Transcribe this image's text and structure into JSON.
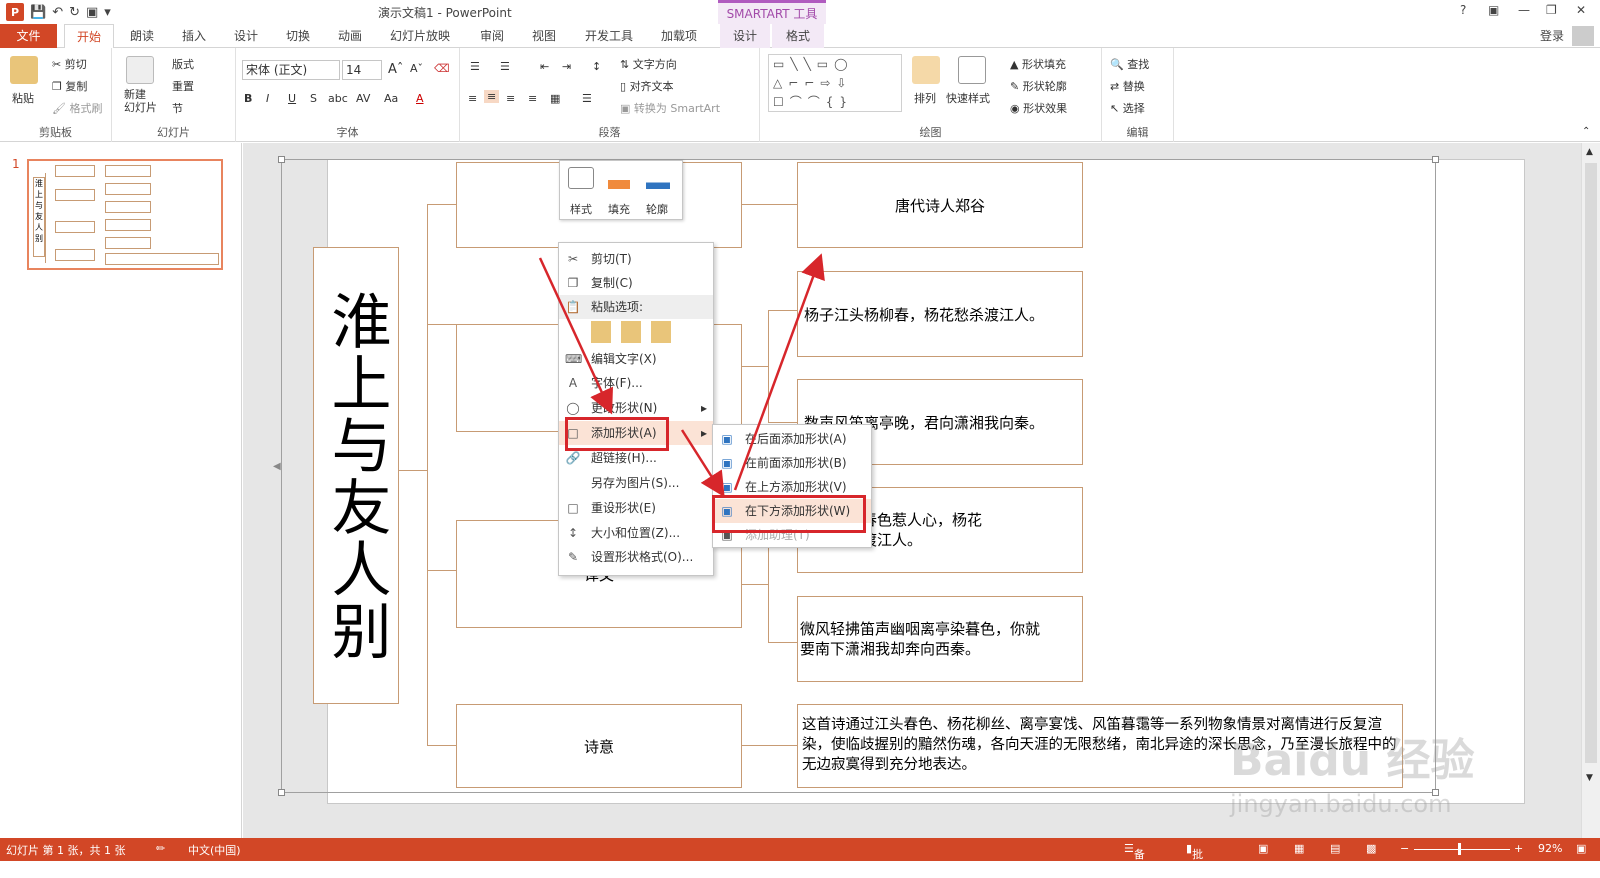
{
  "titlebar": {
    "document_title": "演示文稿1 - PowerPoint",
    "context_tab_group": "SMARTART 工具",
    "help": "?",
    "login": "登录"
  },
  "tabs": [
    "文件",
    "开始",
    "朗读",
    "插入",
    "设计",
    "切换",
    "动画",
    "幻灯片放映",
    "审阅",
    "视图",
    "开发工具",
    "加载项",
    "设计",
    "格式"
  ],
  "ribbon": {
    "clipboard": {
      "paste": "粘贴",
      "cut": "剪切",
      "copy": "复制",
      "format_painter": "格式刷",
      "label": "剪贴板"
    },
    "slides": {
      "new_slide": "新建\n幻灯片",
      "layout": "版式",
      "reset": "重置",
      "section": "节",
      "label": "幻灯片"
    },
    "font": {
      "font_name": "宋体 (正文)",
      "font_size": "14",
      "label": "字体"
    },
    "paragraph": {
      "text_direction": "文字方向",
      "align_text": "对齐文本",
      "convert_smartart": "转换为 SmartArt",
      "label": "段落"
    },
    "drawing": {
      "arrange": "排列",
      "quick_styles": "快速样式",
      "shape_fill": "形状填充",
      "shape_outline": "形状轮廓",
      "shape_effects": "形状效果",
      "label": "绘图"
    },
    "editing": {
      "find": "查找",
      "replace": "替换",
      "select": "选择",
      "label": "编辑"
    }
  },
  "slide_panel": {
    "number": "1"
  },
  "slide": {
    "title_chars": "淮上与友人别",
    "author": "唐代诗人郑谷",
    "line1": "杨子江头杨柳春，杨花愁杀渡江人。",
    "line2": "数声风笛离亭晚，君向潇湘我向秦。",
    "trans1": "扬柳青青春色惹人心，杨花\n飞舞愁杀渡江人。",
    "trans2": "微风轻拂笛声幽咽离亭染暮色，你就\n要南下潇湘我却奔向西秦。",
    "meaning": "这首诗通过江头春色、杨花柳丝、离亭宴饯、风笛暮霭等一系列物象情景对离情进行反复渲染，使临歧握别的黯然伤魂，各向天涯的无限愁绪，南北异途的深长思念，乃至漫长旅程中的无边寂寞得到充分地表达。",
    "label_yiwen": "译文",
    "label_shiyi": "诗意"
  },
  "mini_toolbar": {
    "style": "样式",
    "fill": "填充",
    "outline": "轮廓"
  },
  "context_menu": {
    "items": [
      "剪切(T)",
      "复制(C)",
      "粘贴选项:",
      "编辑文字(X)",
      "字体(F)...",
      "更改形状(N)",
      "添加形状(A)",
      "超链接(H)...",
      "另存为图片(S)...",
      "重设形状(E)",
      "大小和位置(Z)...",
      "设置形状格式(O)..."
    ]
  },
  "submenu": {
    "items": [
      "在后面添加形状(A)",
      "在前面添加形状(B)",
      "在上方添加形状(V)",
      "在下方添加形状(W)",
      "添加助理(T)"
    ]
  },
  "statusbar": {
    "slide_info": "幻灯片 第 1 张，共 1 张",
    "language": "中文(中国)",
    "notes": "备注",
    "comments": "批注",
    "zoom": "92%"
  },
  "watermark": {
    "text": "Baidu 经验",
    "url": "jingyan.baidu.com"
  },
  "colors": {
    "accent": "#d24726",
    "annotation": "#d7262b",
    "shape_border": "#c79b74",
    "context": "#a24aa9"
  }
}
